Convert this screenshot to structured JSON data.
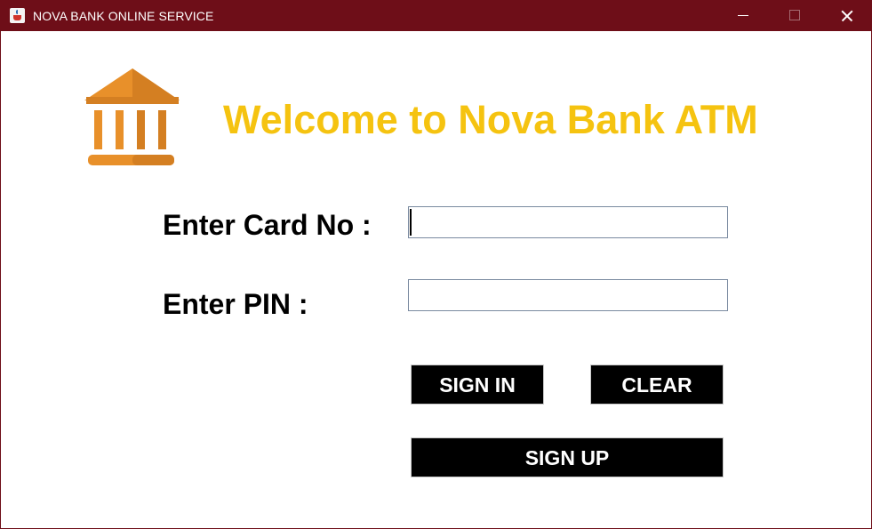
{
  "window": {
    "title": "NOVA BANK ONLINE SERVICE",
    "app_icon": "java-cup-icon",
    "controls": {
      "minimize_icon": "minimize-icon",
      "maximize_icon": "maximize-icon",
      "close_icon": "close-icon"
    }
  },
  "logo": {
    "icon": "bank-building-icon"
  },
  "heading": {
    "text": "Welcome to Nova Bank ATM",
    "color": "#f5c310"
  },
  "form": {
    "card_label": "Enter Card No :",
    "card_value": "",
    "pin_label": "Enter PIN :",
    "pin_value": ""
  },
  "buttons": {
    "sign_in": "SIGN IN",
    "clear": "CLEAR",
    "sign_up": "SIGN UP"
  },
  "colors": {
    "titlebar": "#6e0e18",
    "button_bg": "#000000",
    "button_text": "#ffffff",
    "logo_orange": "#e8902a"
  }
}
